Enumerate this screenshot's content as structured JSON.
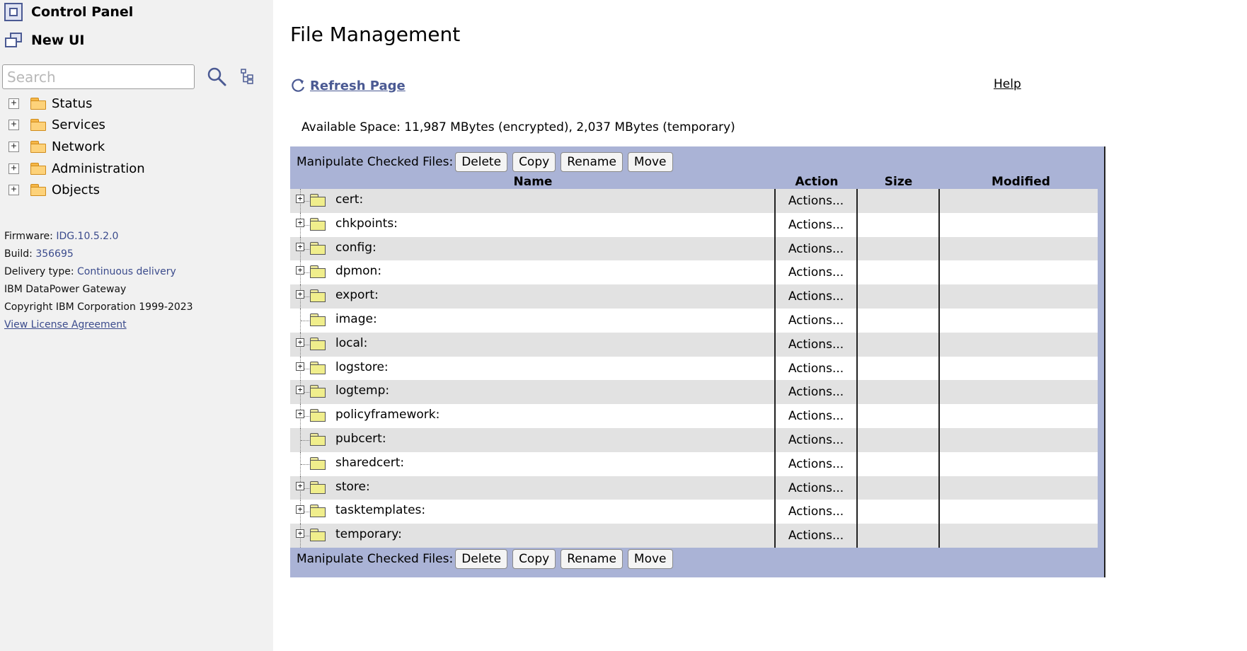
{
  "sidebar": {
    "control_panel": "Control Panel",
    "new_ui": "New UI",
    "search_placeholder": "Search",
    "nav": [
      "Status",
      "Services",
      "Network",
      "Administration",
      "Objects"
    ],
    "firmware_label": "Firmware:",
    "firmware_value": "IDG.10.5.2.0",
    "build_label": "Build:",
    "build_value": "356695",
    "delivery_label": "Delivery type:",
    "delivery_value": "Continuous delivery",
    "product": "IBM DataPower Gateway",
    "copyright": "Copyright IBM Corporation 1999-2023",
    "license": "View License Agreement"
  },
  "main": {
    "title": "File Management",
    "refresh": "Refresh Page",
    "help": "Help",
    "available_space": "Available Space: 11,987 MBytes (encrypted), 2,037 MBytes (temporary)",
    "manipulate_label": "Manipulate Checked Files:",
    "buttons": {
      "delete": "Delete",
      "copy": "Copy",
      "rename": "Rename",
      "move": "Move"
    },
    "columns": {
      "name": "Name",
      "action": "Action",
      "size": "Size",
      "modified": "Modified"
    },
    "action_text": "Actions...",
    "folders": [
      {
        "name": "cert:",
        "expandable": true
      },
      {
        "name": "chkpoints:",
        "expandable": true
      },
      {
        "name": "config:",
        "expandable": true
      },
      {
        "name": "dpmon:",
        "expandable": true
      },
      {
        "name": "export:",
        "expandable": true
      },
      {
        "name": "image:",
        "expandable": false
      },
      {
        "name": "local:",
        "expandable": true
      },
      {
        "name": "logstore:",
        "expandable": true
      },
      {
        "name": "logtemp:",
        "expandable": true
      },
      {
        "name": "policyframework:",
        "expandable": true
      },
      {
        "name": "pubcert:",
        "expandable": false
      },
      {
        "name": "sharedcert:",
        "expandable": false
      },
      {
        "name": "store:",
        "expandable": true
      },
      {
        "name": "tasktemplates:",
        "expandable": true
      },
      {
        "name": "temporary:",
        "expandable": true
      }
    ]
  },
  "colors": {
    "panel": "#aab3d6",
    "link": "#4b5a93",
    "sidebar": "#f1f1f1"
  }
}
